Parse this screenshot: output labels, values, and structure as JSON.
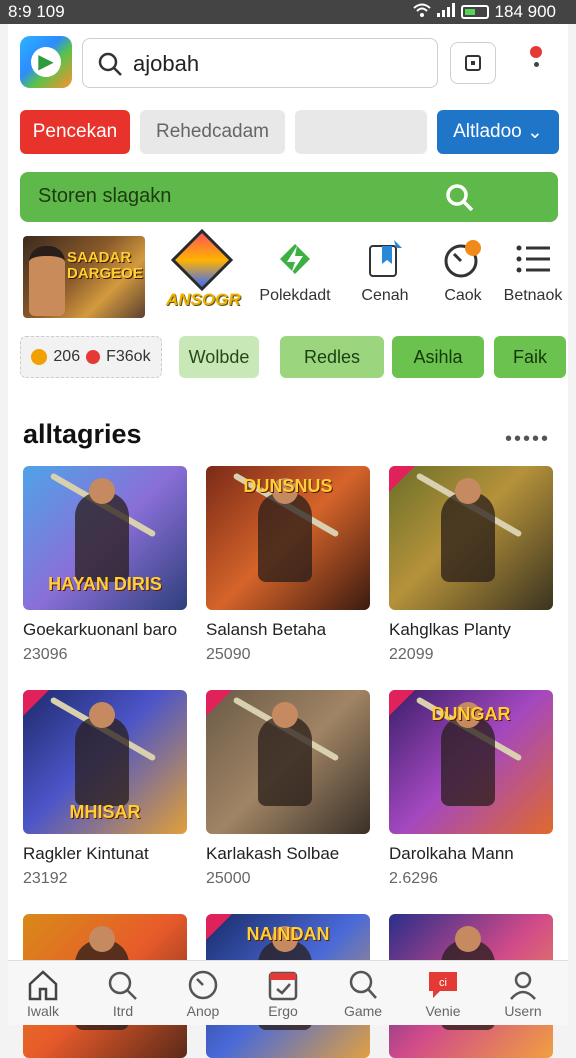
{
  "status_bar": {
    "time": "8:9 109",
    "right_text": "184 900"
  },
  "search": {
    "value": "ajobah"
  },
  "filters": [
    {
      "label": "Pencekan"
    },
    {
      "label": "Rehedcadam"
    },
    {
      "label": ""
    },
    {
      "label": "Altladoo",
      "suffix": "⌄"
    }
  ],
  "green_search": {
    "label": "Storen slagakn"
  },
  "shortcuts": {
    "promo_title": "SAADAR DARGEOE",
    "game_logo_text": "ANSOGR",
    "items": [
      {
        "label": "Polekdadt",
        "icon": "lightning-bolt-icon"
      },
      {
        "label": "Cenah",
        "icon": "bookmark-bag-icon"
      },
      {
        "label": "Caok",
        "icon": "timer-icon"
      },
      {
        "label": "Betnaok",
        "icon": "list-icon"
      }
    ]
  },
  "chips": {
    "first_value": "206",
    "first_label": "F36ok",
    "items": [
      {
        "label": "Wolbde"
      },
      {
        "label": "Redles"
      },
      {
        "label": "Asihla"
      },
      {
        "label": "Faik"
      }
    ]
  },
  "section": {
    "title": "alltagries",
    "more": "•••••"
  },
  "cards": [
    {
      "title": "Goekarkuonanl baro",
      "count": "23096",
      "thumb_text": "HAYAN DIRIS",
      "bg": "linear-gradient(135deg,#4fa3e8,#8a6fd8 50%,#2e3f7a)",
      "badge": false
    },
    {
      "title": "Salansh Betaha",
      "count": "25090",
      "thumb_text": "DUNSNUS",
      "bg": "linear-gradient(135deg,#7a2a18,#d5642a 50%,#3b1a10)",
      "badge": false
    },
    {
      "title": "Kahglkas Planty",
      "count": "22099",
      "thumb_text": "",
      "bg": "linear-gradient(135deg,#6b6f2a,#b5923a 45%,#3a3320)",
      "badge": true
    },
    {
      "title": "Ragkler Kintunat",
      "count": "23192",
      "thumb_text": "MHISAR",
      "bg": "linear-gradient(135deg,#1d2a6a,#4c55c8 45%,#e0a038)",
      "badge": true
    },
    {
      "title": "Karlakash Solbae",
      "count": "25000",
      "thumb_text": "",
      "bg": "linear-gradient(135deg,#6a5a48,#a08464 50%,#3a3028)",
      "badge": true
    },
    {
      "title": "Darolkaha Mann",
      "count": "2.6296",
      "thumb_text": "DUNGAR",
      "bg": "linear-gradient(135deg,#3a1f6a,#a448c0 50%,#e06a2a)",
      "badge": true
    },
    {
      "title": "",
      "count": "",
      "thumb_text": "",
      "bg": "linear-gradient(135deg,#d88a1a,#e85a2a 50%,#5a2a1a)",
      "badge": false
    },
    {
      "title": "",
      "count": "",
      "thumb_text": "NAINDAN",
      "bg": "linear-gradient(135deg,#1a2c6a,#4a6ad8 50%,#e0a040)",
      "badge": true
    },
    {
      "title": "",
      "count": "",
      "thumb_text": "",
      "bg": "linear-gradient(135deg,#2a2e8a,#d04a8a 50%,#f0a040)",
      "badge": false
    }
  ],
  "bottom_nav": [
    {
      "label": "Iwalk",
      "icon": "home-icon"
    },
    {
      "label": "Itrd",
      "icon": "search-icon"
    },
    {
      "label": "Anop",
      "icon": "clock-icon"
    },
    {
      "label": "Ergo",
      "icon": "calendar-icon"
    },
    {
      "label": "Game",
      "icon": "search-icon"
    },
    {
      "label": "Venie",
      "icon": "chat-icon"
    },
    {
      "label": "Usern",
      "icon": "user-icon"
    }
  ]
}
